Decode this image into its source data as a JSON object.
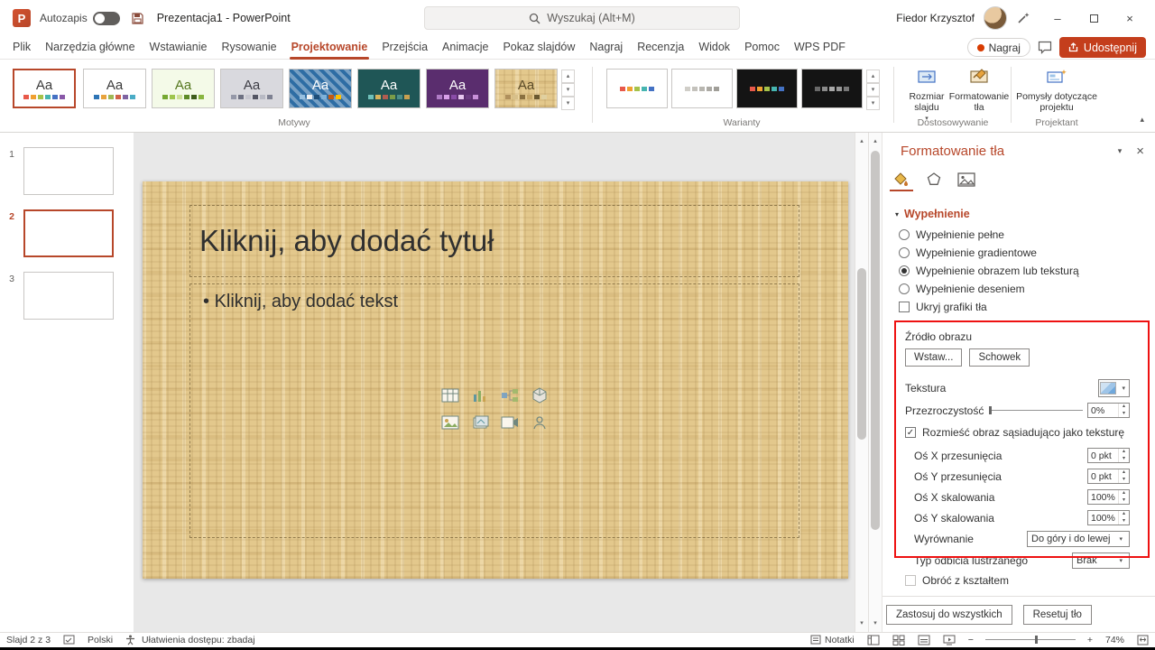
{
  "titlebar": {
    "autosave_label": "Autozapis",
    "doc_title": "Prezentacja1 - PowerPoint",
    "search_placeholder": "Wyszukaj (Alt+M)",
    "user_name": "Fiedor Krzysztof"
  },
  "tabs": [
    {
      "label": "Plik",
      "active": false
    },
    {
      "label": "Narzędzia główne",
      "active": false
    },
    {
      "label": "Wstawianie",
      "active": false
    },
    {
      "label": "Rysowanie",
      "active": false
    },
    {
      "label": "Projektowanie",
      "active": true
    },
    {
      "label": "Przejścia",
      "active": false
    },
    {
      "label": "Animacje",
      "active": false
    },
    {
      "label": "Pokaz slajdów",
      "active": false
    },
    {
      "label": "Nagraj",
      "active": false
    },
    {
      "label": "Recenzja",
      "active": false
    },
    {
      "label": "Widok",
      "active": false
    },
    {
      "label": "Pomoc",
      "active": false
    },
    {
      "label": "WPS PDF",
      "active": false
    }
  ],
  "tab_actions": {
    "record_label": "Nagraj",
    "share_label": "Udostępnij"
  },
  "ribbon": {
    "themes_label": "Motywy",
    "variants_label": "Warianty",
    "slide_size_label": "Rozmiar slajdu",
    "format_bg_label": "Formatowanie tła",
    "customize_label": "Dostosowywanie",
    "design_ideas_label": "Pomysły dotyczące projektu",
    "designer_label": "Projektant"
  },
  "themes": [
    {
      "label": "Aa",
      "bg": "#ffffff",
      "fg": "#3b3b3b",
      "selected": true,
      "swatches": [
        "#e8594a",
        "#f0a030",
        "#a5c24a",
        "#46b5b0",
        "#4472c4",
        "#8958a8"
      ]
    },
    {
      "label": "Aa",
      "bg": "#ffffff",
      "fg": "#3b3b3b",
      "selected": false,
      "swatches": [
        "#2e75b6",
        "#e8a33d",
        "#9fb855",
        "#d16349",
        "#8064a2",
        "#4bacc6"
      ]
    },
    {
      "label": "Aa",
      "bg": "#f4fae8",
      "fg": "#55771f",
      "selected": false,
      "swatches": [
        "#76a832",
        "#9fc54e",
        "#cfe09a",
        "#5d8a28",
        "#3e5c1c",
        "#89b540"
      ]
    },
    {
      "label": "Aa",
      "bg": "#d9d9de",
      "fg": "#3c3c44",
      "selected": false,
      "swatches": [
        "#9598a8",
        "#6e7182",
        "#c8c8d0",
        "#545664",
        "#b8bac4",
        "#7e8192"
      ]
    },
    {
      "label": "Aa",
      "bg": "#2e6da4",
      "fg": "#ffffff",
      "selected": false,
      "swatches": [
        "#98c0e0",
        "#f2f2f2",
        "#1e4e79",
        "#7fb2d9",
        "#c55a11",
        "#ffc000"
      ]
    },
    {
      "label": "Aa",
      "bg": "#1f5656",
      "fg": "#ffffff",
      "selected": false,
      "swatches": [
        "#6fc0ba",
        "#d8b25c",
        "#b05c50",
        "#7a9c48",
        "#4a8e8a",
        "#c8a050"
      ]
    },
    {
      "label": "Aa",
      "bg": "#5a2d6e",
      "fg": "#ffffff",
      "selected": false,
      "swatches": [
        "#b07cc6",
        "#d8a0e8",
        "#8a4ca8",
        "#e8c8f0",
        "#6a3a80",
        "#c890d8"
      ]
    },
    {
      "label": "Aa",
      "bg": "#e3c88c",
      "fg": "#5a4a28",
      "selected": false,
      "swatches": [
        "#b0905c",
        "#d8c08a",
        "#8a7040",
        "#c8a868",
        "#6a5830",
        "#e0d0a0"
      ]
    }
  ],
  "variants": [
    {
      "bg": "#ffffff",
      "swatches": [
        "#e8594a",
        "#f0a030",
        "#a5c24a",
        "#46b5b0",
        "#4472c4"
      ]
    },
    {
      "bg": "#ffffff",
      "swatches": [
        "#d0cec8",
        "#c4c2bc",
        "#b8b6b0",
        "#acaaa4",
        "#a09e98"
      ]
    },
    {
      "bg": "#141414",
      "swatches": [
        "#e8594a",
        "#f0a030",
        "#a5c24a",
        "#46b5b0",
        "#4472c4"
      ]
    },
    {
      "bg": "#141414",
      "swatches": [
        "#6a6a6a",
        "#8a8a8a",
        "#a8a8a8",
        "#989898",
        "#787878"
      ]
    }
  ],
  "slides_panel": [
    {
      "number": "1",
      "selected": false,
      "textured": false
    },
    {
      "number": "2",
      "selected": true,
      "textured": true
    },
    {
      "number": "3",
      "selected": false,
      "textured": false
    }
  ],
  "slide": {
    "title_placeholder": "Kliknij, aby dodać tytuł",
    "body_bullet": "•",
    "body_placeholder": "Kliknij, aby dodać tekst"
  },
  "panel": {
    "title": "Formatowanie tła",
    "fill_header": "Wypełnienie",
    "fill_options": [
      {
        "label": "Wypełnienie pełne",
        "selected": false
      },
      {
        "label": "Wypełnienie gradientowe",
        "selected": false
      },
      {
        "label": "Wypełnienie obrazem lub teksturą",
        "selected": true
      },
      {
        "label": "Wypełnienie deseniem",
        "selected": false
      }
    ],
    "hide_bg_label": "Ukryj grafiki tła",
    "hide_bg_checked": false,
    "image_source_label": "Źródło obrazu",
    "insert_button": "Wstaw...",
    "clipboard_button": "Schowek",
    "texture_label": "Tekstura",
    "transparency_label": "Przezroczystość",
    "transparency_value": "0%",
    "tile_checkbox_label": "Rozmieść obraz sąsiadująco jako teksturę",
    "tile_checked": true,
    "check_glyph": "✓",
    "offsets": [
      {
        "label": "Oś X przesunięcia",
        "value": "0 pkt"
      },
      {
        "label": "Oś Y przesunięcia",
        "value": "0 pkt"
      },
      {
        "label": "Oś X skalowania",
        "value": "100%"
      },
      {
        "label": "Oś Y skalowania",
        "value": "100%"
      }
    ],
    "alignment_label": "Wyrównanie",
    "alignment_value": "Do góry i do lewej",
    "mirror_label": "Typ odbicia lustrzanego",
    "mirror_value": "Brak",
    "rotate_label": "Obróć z kształtem",
    "rotate_disabled": true,
    "apply_all_button": "Zastosuj do wszystkich",
    "reset_button": "Resetuj tło"
  },
  "statusbar": {
    "slide_indicator": "Slajd 2 z 3",
    "language": "Polski",
    "accessibility": "Ułatwienia dostępu: zbadaj",
    "notes_label": "Notatki",
    "zoom_value": "74%"
  },
  "glyphs": {
    "up": "▴",
    "down": "▾",
    "minus": "–",
    "close": "×",
    "plus": "+",
    "minus_zoom": "−"
  },
  "colors": {
    "accent": "#b7472a",
    "share_bg": "#c43e1c",
    "highlight": "#ee1111",
    "texture_base": "#e3c88c"
  }
}
